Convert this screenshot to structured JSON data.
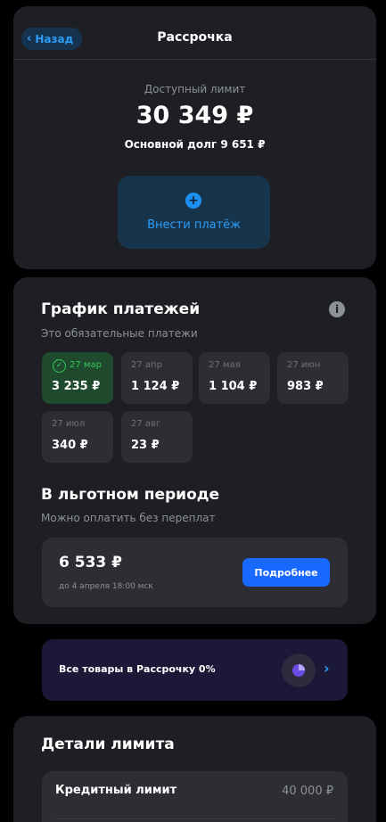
{
  "header": {
    "back_label": "Назад",
    "title": "Рассрочка"
  },
  "summary": {
    "limit_label": "Доступный лимит",
    "limit_value": "30 349 ₽",
    "debt": "Основной долг 9 651 ₽",
    "pay_button": "Внести платёж"
  },
  "schedule": {
    "title": "График платежей",
    "subtitle": "Это обязательные платежи",
    "payments": [
      {
        "date": "27 мар",
        "amount": "3 235 ₽",
        "active": true
      },
      {
        "date": "27 апр",
        "amount": "1 124 ₽"
      },
      {
        "date": "27 мая",
        "amount": "1 104 ₽"
      },
      {
        "date": "27 июн",
        "amount": "983 ₽"
      },
      {
        "date": "27 июл",
        "amount": "340 ₽"
      },
      {
        "date": "27 авг",
        "amount": "23 ₽"
      }
    ]
  },
  "grace": {
    "title": "В льготном периоде",
    "subtitle": "Можно оплатить без переплат",
    "amount": "6 533 ₽",
    "until": "до 4 апреля 18:00 мск",
    "button": "Подробнее"
  },
  "promo": {
    "text": "Все товары в Рассрочку 0%"
  },
  "details": {
    "title": "Детали лимита",
    "rows": [
      {
        "label": "Кредитный лимит",
        "value": "40 000 ₽"
      }
    ]
  },
  "colors": {
    "accent_blue": "#2d9cf5",
    "button_blue": "#1769ff",
    "success_green": "#35c85b",
    "card_bg": "#1d1f24"
  }
}
